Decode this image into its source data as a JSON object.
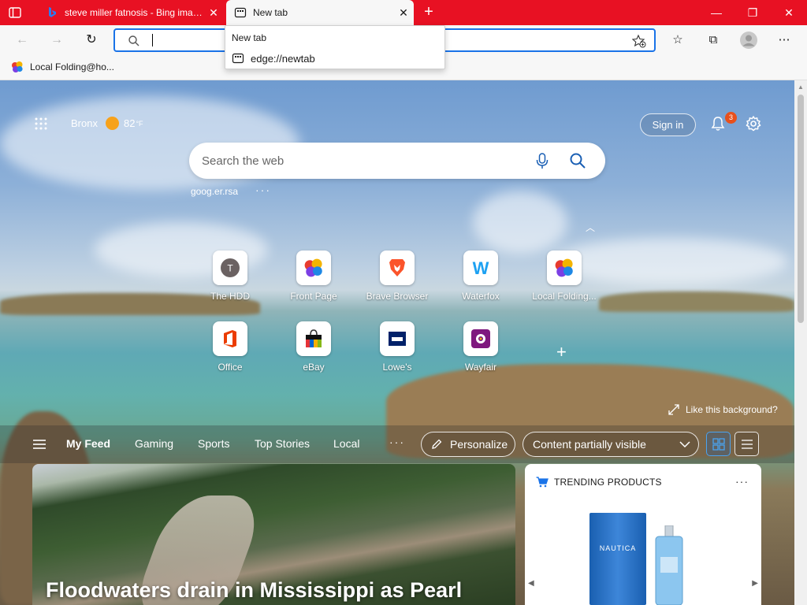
{
  "browser": {
    "tabs": [
      {
        "title": "steve miller fatnosis - Bing image",
        "active": false
      },
      {
        "title": "New tab",
        "active": true
      }
    ],
    "new_tab_symbol": "+",
    "address_value": "",
    "favorites": [
      {
        "label": "Local Folding@ho..."
      }
    ],
    "dropdown": {
      "header": "New tab",
      "suggestion": "edge://newtab"
    },
    "accent_color": "#e81123"
  },
  "ntp": {
    "weather": {
      "location": "Bronx",
      "temperature": "82",
      "unit": "°F"
    },
    "sign_in_label": "Sign in",
    "notification_count": "3",
    "search_placeholder": "Search the web",
    "quick_link": "goog.er.rsa",
    "quick_link_more": "···",
    "tiles_row1": [
      {
        "label": "The HDD",
        "icon": "letter-t-icon",
        "letter": "T"
      },
      {
        "label": "Front Page",
        "icon": "folding-at-home-icon"
      },
      {
        "label": "Brave Browser",
        "icon": "brave-lion-icon"
      },
      {
        "label": "Waterfox",
        "icon": "waterfox-w-icon",
        "letter": "W"
      },
      {
        "label": "Local Folding...",
        "icon": "folding-at-home-icon"
      }
    ],
    "tiles_row2": [
      {
        "label": "Office",
        "icon": "office-icon"
      },
      {
        "label": "eBay",
        "icon": "ebay-bag-icon"
      },
      {
        "label": "Lowe's",
        "icon": "lowes-icon"
      },
      {
        "label": "Wayfair",
        "icon": "wayfair-icon"
      }
    ],
    "add_tile_symbol": "+",
    "like_background": "Like this background?"
  },
  "feed": {
    "tabs": [
      "My Feed",
      "Gaming",
      "Sports",
      "Top Stories",
      "Local"
    ],
    "more": "···",
    "personalize_label": "Personalize",
    "content_visibility": "Content partially visible",
    "news_headline": "Floodwaters drain in Mississippi as Pearl",
    "trending_title": "TRENDING PRODUCTS",
    "trending_more": "···",
    "product_brand": "NAUTICA"
  }
}
